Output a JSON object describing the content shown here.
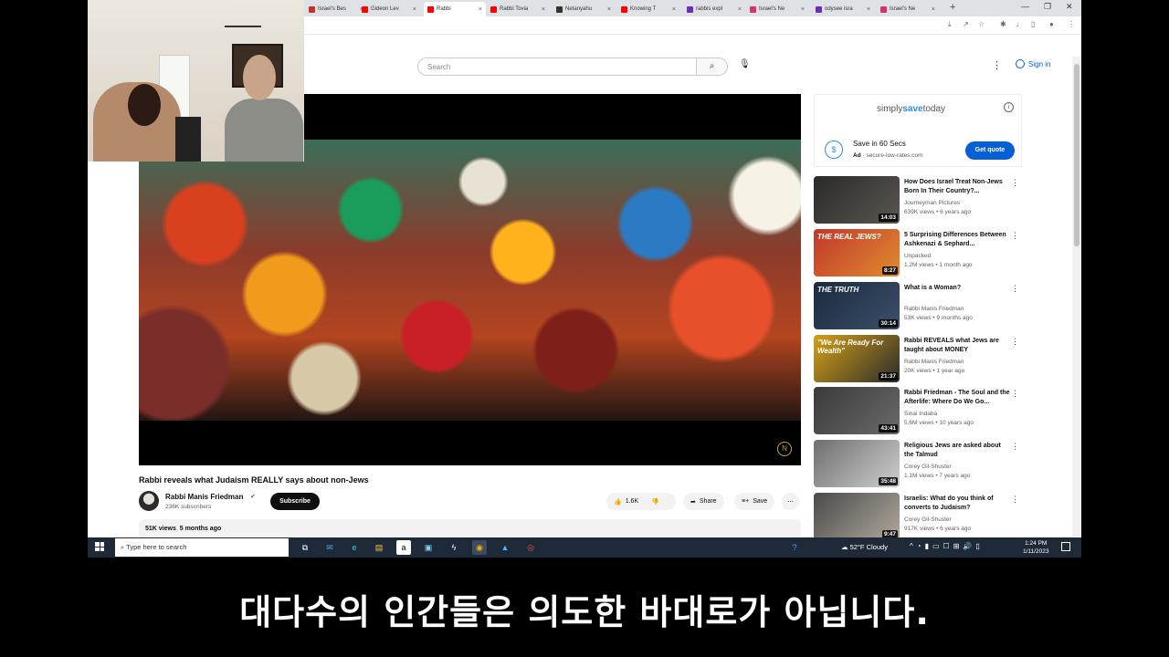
{
  "browser": {
    "tabs": [
      {
        "label": "Israel's Bes",
        "color": "#c9302c"
      },
      {
        "label": "Gideon Lev",
        "color": "#ff0000"
      },
      {
        "label": "Rabbi",
        "color": "#ff0000",
        "active": true
      },
      {
        "label": "Rabbi Tovia",
        "color": "#ff0000"
      },
      {
        "label": "Netanyahu",
        "color": "#333333"
      },
      {
        "label": "Knowing T",
        "color": "#ff0000"
      },
      {
        "label": "rabbis expl",
        "color": "#6b2fb5"
      },
      {
        "label": "Israel's Ne",
        "color": "#d6336c"
      },
      {
        "label": "odysee isra",
        "color": "#6b2fb5"
      },
      {
        "label": "Israel's Ne",
        "color": "#d6336c"
      }
    ],
    "new_tab": "+",
    "close_glyph": "×"
  },
  "youtube": {
    "search_placeholder": "Search",
    "sign_in": "Sign in"
  },
  "video": {
    "title": "Rabbi reveals what Judaism REALLY says about non-Jews",
    "channel": "Rabbi Manis Friedman",
    "subscribers": "236K subscribers",
    "subscribe_label": "Subscribe",
    "likes": "1.6K",
    "share_label": "Share",
    "save_label": "Save",
    "more_label": "⋯",
    "views": "51K views",
    "age": "5 months ago"
  },
  "ad": {
    "logo_prefix": "simply",
    "logo_brand": "save",
    "logo_suffix": "today",
    "headline": "Save in 60 Secs",
    "ad_badge": "Ad",
    "domain": "secure-low-rates.com",
    "cta": "Get quote"
  },
  "related": [
    {
      "title": "How Does Israel Treat Non-Jews Born In Their Country?...",
      "channel": "Journeyman Pictures",
      "views": "639K views",
      "age": "6 years ago",
      "duration": "14:03",
      "thumb_text": "",
      "colors": [
        "#2a2a2a",
        "#5a5650"
      ]
    },
    {
      "title": "5 Surprising Differences Between Ashkenazi & Sephard...",
      "channel": "Unpacked",
      "views": "1.2M views",
      "age": "1 month ago",
      "duration": "8:27",
      "thumb_text": "THE REAL JEWS?",
      "colors": [
        "#c0392b",
        "#e08a2f"
      ]
    },
    {
      "title": "What is a Woman?",
      "channel": "Rabbi Manis Friedman",
      "views": "53K views",
      "age": "9 months ago",
      "duration": "30:14",
      "thumb_text": "THE TRUTH",
      "colors": [
        "#1b2b3f",
        "#3c4f6a"
      ]
    },
    {
      "title": "Rabbi REVEALS what Jews are taught about MONEY",
      "channel": "Rabbi Manis Friedman",
      "views": "20K views",
      "age": "1 year ago",
      "duration": "21:37",
      "thumb_text": "\"We Are Ready For Wealth\"",
      "colors": [
        "#d4a017",
        "#2b2b2b"
      ]
    },
    {
      "title": "Rabbi Friedman - The Soul and the Afterlife: Where Do We Go...",
      "channel": "Sinai Indaba",
      "views": "5.6M views",
      "age": "10 years ago",
      "duration": "43:41",
      "thumb_text": "",
      "colors": [
        "#3a3a3a",
        "#6a6a6a"
      ]
    },
    {
      "title": "Religious Jews are asked about the Talmud",
      "channel": "Corey Gil-Shuster",
      "views": "1.1M views",
      "age": "7 years ago",
      "duration": "35:48",
      "thumb_text": "",
      "colors": [
        "#6e6e6e",
        "#cfcfcf"
      ]
    },
    {
      "title": "Israelis: What do you think of converts to Judaism?",
      "channel": "Corey Gil-Shuster",
      "views": "917K views",
      "age": "6 years ago",
      "duration": "9:47",
      "thumb_text": "",
      "colors": [
        "#4a4a4a",
        "#b0a89c"
      ]
    }
  ],
  "taskbar": {
    "search_placeholder": "Type here to search",
    "weather": "52°F  Cloudy",
    "time": "1:24 PM",
    "date": "1/11/2023"
  },
  "subtitle": "대다수의 인간들은 의도한 바대로가 아닙니다."
}
